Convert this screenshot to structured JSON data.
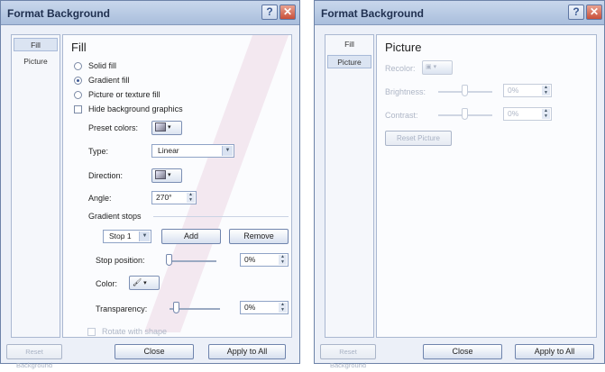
{
  "left_dialog": {
    "title": "Format Background",
    "nav": [
      "Fill",
      "Picture"
    ],
    "heading": "Fill",
    "fill_options": [
      "Solid fill",
      "Gradient fill",
      "Picture or texture fill"
    ],
    "hide_background": "Hide background graphics",
    "preset_colors_label": "Preset colors:",
    "type_label": "Type:",
    "type_value": "Linear",
    "direction_label": "Direction:",
    "angle_label": "Angle:",
    "angle_value": "270°",
    "gradient_stops_label": "Gradient stops",
    "stop_value": "Stop 1",
    "add_label": "Add",
    "remove_label": "Remove",
    "stop_position_label": "Stop position:",
    "stop_position_value": "0%",
    "color_label": "Color:",
    "transparency_label": "Transparency:",
    "transparency_value": "0%",
    "rotate_label": "Rotate with shape",
    "reset_label": "Reset Background",
    "close_label": "Close",
    "apply_label": "Apply to All"
  },
  "right_dialog": {
    "title": "Format Background",
    "nav": [
      "Fill",
      "Picture"
    ],
    "heading": "Picture",
    "recolor_label": "Recolor:",
    "brightness_label": "Brightness:",
    "brightness_value": "0%",
    "contrast_label": "Contrast:",
    "contrast_value": "0%",
    "reset_picture_label": "Reset Picture",
    "reset_label": "Reset Background",
    "close_label": "Close",
    "apply_label": "Apply to All"
  }
}
